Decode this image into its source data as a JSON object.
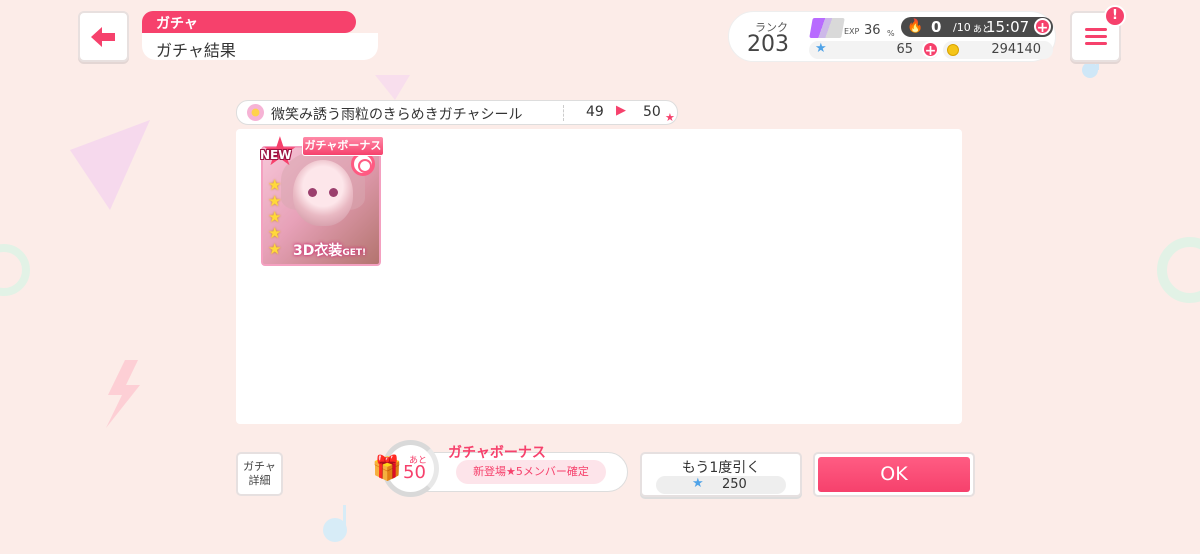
{
  "header": {
    "back_label": "back",
    "category": "ガチャ",
    "title": "ガチャ結果"
  },
  "status": {
    "rank_label": "ランク",
    "rank": "203",
    "exp_label": "EXP",
    "exp_value": "36",
    "exp_unit": "%",
    "stamina_current": "0",
    "stamina_max": "/10",
    "stamina_remaining_label": "あと",
    "stamina_remaining": "15:07",
    "star_gems": "65",
    "coins": "294140"
  },
  "item_row": {
    "name": "微笑み誘う雨粒のきらめきガチャシール",
    "before": "49",
    "after": "50"
  },
  "result": {
    "cards": [
      {
        "new_label": "NEW",
        "bonus_tag": "ガチャボーナス",
        "rarity": 5,
        "overlay_text": "3D衣装",
        "overlay_suffix": "GET!"
      }
    ]
  },
  "footer": {
    "detail_label_1": "ガチャ",
    "detail_label_2": "詳細",
    "bonus_remaining_label": "あと",
    "bonus_remaining": "50",
    "bonus_title": "ガチャボーナス",
    "bonus_desc": "新登場★5メンバー確定",
    "again_label": "もう1度引く",
    "again_cost": "250",
    "ok_label": "OK"
  },
  "colors": {
    "accent": "#f6416c",
    "background": "#fcece8",
    "star_gem": "#4fa3e8",
    "coin": "#f5c518"
  },
  "icons": {
    "back": "arrow-left-icon",
    "menu": "hamburger-icon",
    "notify": "exclamation-icon",
    "stamina": "flame-icon",
    "star_gem": "star-gem-icon",
    "coin": "coin-icon",
    "gift": "gift-icon"
  }
}
